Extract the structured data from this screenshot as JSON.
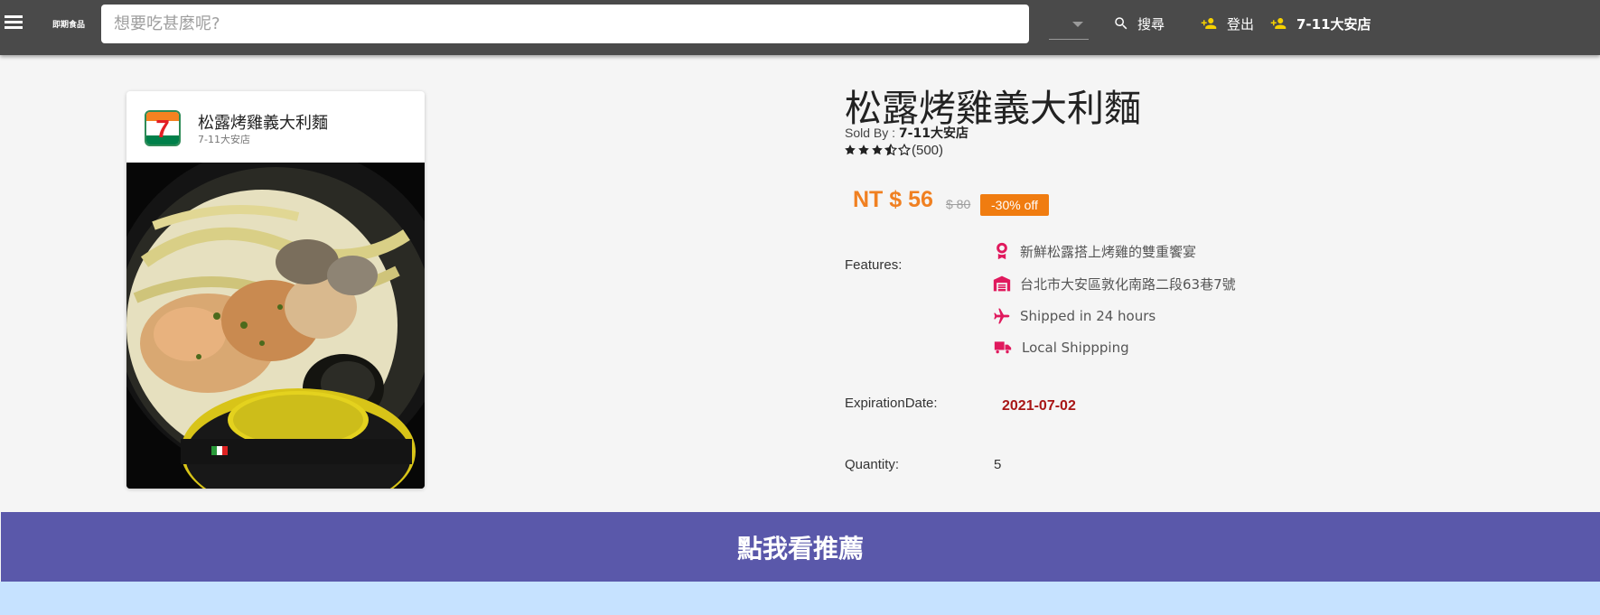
{
  "topbar": {
    "brand": "即期食品",
    "search_placeholder": "想要吃甚麼呢?",
    "search_button": "搜尋",
    "logout_button": "登出",
    "store_button": "7-11大安店"
  },
  "card": {
    "title": "松露烤雞義大利麵",
    "subtitle": "7-11大安店",
    "logo_text": "7"
  },
  "product": {
    "title": "松露烤雞義大利麵",
    "sold_by_label": "Sold By :",
    "sold_by_value": "7-11大安店",
    "rating": 3.5,
    "rating_max": 5,
    "rating_count": "(500)",
    "price": "NT $ 56",
    "old_price": "$ 80",
    "discount": "-30% off",
    "features_label": "Features:",
    "features": [
      {
        "icon": "award-icon",
        "text": "新鮮松露搭上烤雞的雙重饗宴"
      },
      {
        "icon": "warehouse-icon",
        "text": "台北市大安區敦化南路二段63巷7號"
      },
      {
        "icon": "airplane-icon",
        "text": "Shipped in 24 hours"
      },
      {
        "icon": "truck-icon",
        "text": "Local Shippping"
      }
    ],
    "expiration_label": "ExpirationDate:",
    "expiration_value": "2021-07-02",
    "quantity_label": "Quantity:",
    "quantity_value": "5"
  },
  "recommend_button": "點我看推薦",
  "colors": {
    "topbar": "#4a4a4a",
    "price": "#f08021",
    "discount": "#f07c10",
    "feature_icon": "#e0195d",
    "expiration": "#a81616",
    "recommend": "#5a58aa",
    "bottom": "#c6e2ff"
  }
}
